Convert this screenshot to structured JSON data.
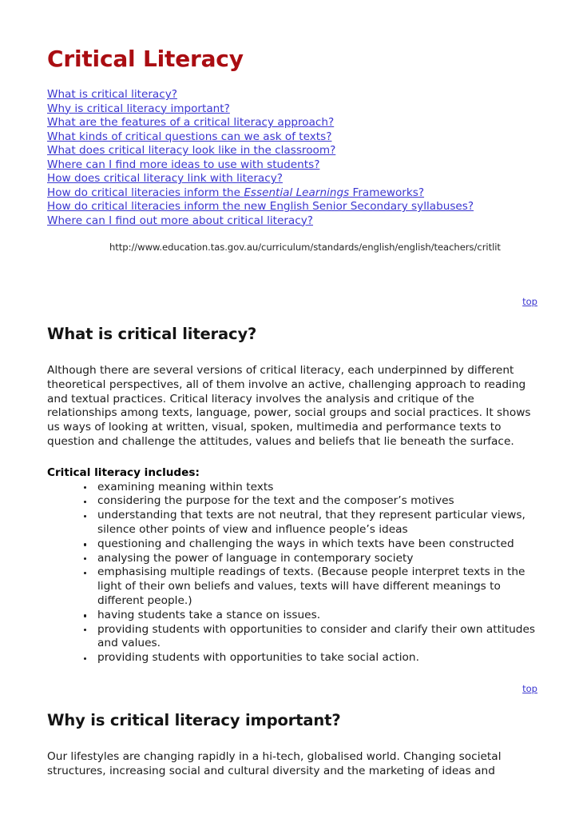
{
  "document": {
    "title": "Critical Literacy",
    "title_color": "#aa0d12",
    "link_color": "#3a36d0",
    "source_url": "http://www.education.tas.gov.au/curriculum/standards/english/english/teachers/critlit",
    "back_to_top_label": "top"
  },
  "toc": {
    "items": [
      {
        "label": "What is critical literacy?"
      },
      {
        "label": "Why is critical literacy important?"
      },
      {
        "label": "What are the features of a critical literacy approach?"
      },
      {
        "label": "What kinds of critical questions can we ask of texts?"
      },
      {
        "label": "What does critical literacy look like in the classroom?"
      },
      {
        "label": "Where can I find more ideas to use with students?"
      },
      {
        "label": "How does critical literacy link with literacy?"
      },
      {
        "label": "How do critical literacies inform the Essential Learnings Frameworks?",
        "prefix": "How do critical literacies inform the ",
        "italic": "Essential Learnings",
        "suffix": " Frameworks?"
      },
      {
        "label": "How do critical literacies inform the new English Senior Secondary syllabuses?"
      },
      {
        "label": "Where can I find out more about critical literacy?"
      }
    ]
  },
  "sections": [
    {
      "heading": "What is critical literacy?",
      "paragraph": "Although there are several versions of critical literacy, each underpinned by different theoretical perspectives, all of them involve an active, challenging approach to reading and textual practices. Critical literacy involves the analysis and critique of the relationships among texts, language, power, social groups and social practices. It shows us ways of looking at written, visual, spoken, multimedia and performance texts to question and challenge the attitudes, values and beliefs that lie beneath the surface.",
      "lead_in": "Critical literacy includes:",
      "bullets": [
        "examining meaning within texts",
        "considering the purpose for the text and the composer’s motives",
        "understanding that texts are not neutral, that they represent particular views, silence other points of view and influence people’s ideas",
        "questioning and challenging the ways in which texts have been constructed",
        "analysing the power of language in contemporary society",
        "emphasising multiple readings of texts. (Because people interpret texts in the light of their own beliefs and values, texts will have different meanings to different people.)",
        "having students take a stance on issues.",
        "providing students with opportunities to consider and clarify their own attitudes and values.",
        "providing students with opportunities to take social action."
      ]
    },
    {
      "heading": "Why is critical literacy important?",
      "paragraph": "Our lifestyles are changing rapidly in a hi-tech, globalised world. Changing societal structures, increasing social and cultural diversity and the marketing of ideas and"
    }
  ]
}
